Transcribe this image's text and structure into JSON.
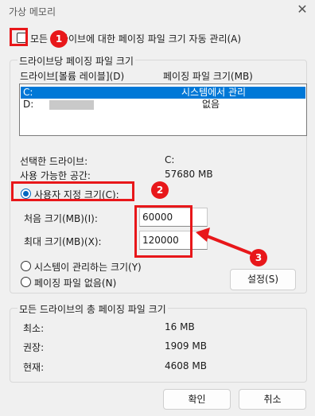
{
  "window": {
    "title": "가상 메모리",
    "close_glyph": "✕"
  },
  "auto_manage": {
    "label": "모든 드라이브에 대한 페이징 파일 크기 자동 관리(A)",
    "checked": false
  },
  "per_drive": {
    "legend": "드라이브당 페이징 파일 크기",
    "columns": [
      "드라이브[볼륨 레이블](D)",
      "페이징 파일 크기(MB)"
    ],
    "rows": [
      {
        "drive": "C:",
        "size": "시스템에서 관리",
        "selected": true
      },
      {
        "drive": "D:",
        "size": "없음",
        "selected": false
      }
    ],
    "selected_drive_label": "선택한 드라이브:",
    "selected_drive_value": "C:",
    "free_space_label": "사용 가능한 공간:",
    "free_space_value": "57680 MB",
    "options": {
      "custom": "사용자 지정 크기(C):",
      "system_managed": "시스템이 관리하는 크기(Y)",
      "no_paging": "페이징 파일 없음(N)"
    },
    "initial_label": "처음 크기(MB)(I):",
    "initial_value": "60000",
    "max_label": "최대 크기(MB)(X):",
    "max_value": "120000",
    "set_button": "설정(S)"
  },
  "total": {
    "legend": "모든 드라이브의 총 페이징 파일 크기",
    "min_label": "최소:",
    "min_value": "16 MB",
    "recommended_label": "권장:",
    "recommended_value": "1909 MB",
    "current_label": "현재:",
    "current_value": "4608 MB"
  },
  "buttons": {
    "ok": "확인",
    "cancel": "취소"
  },
  "annotations": {
    "badge1": "1",
    "badge2": "2",
    "badge3": "3",
    "color": "#e8171a"
  }
}
